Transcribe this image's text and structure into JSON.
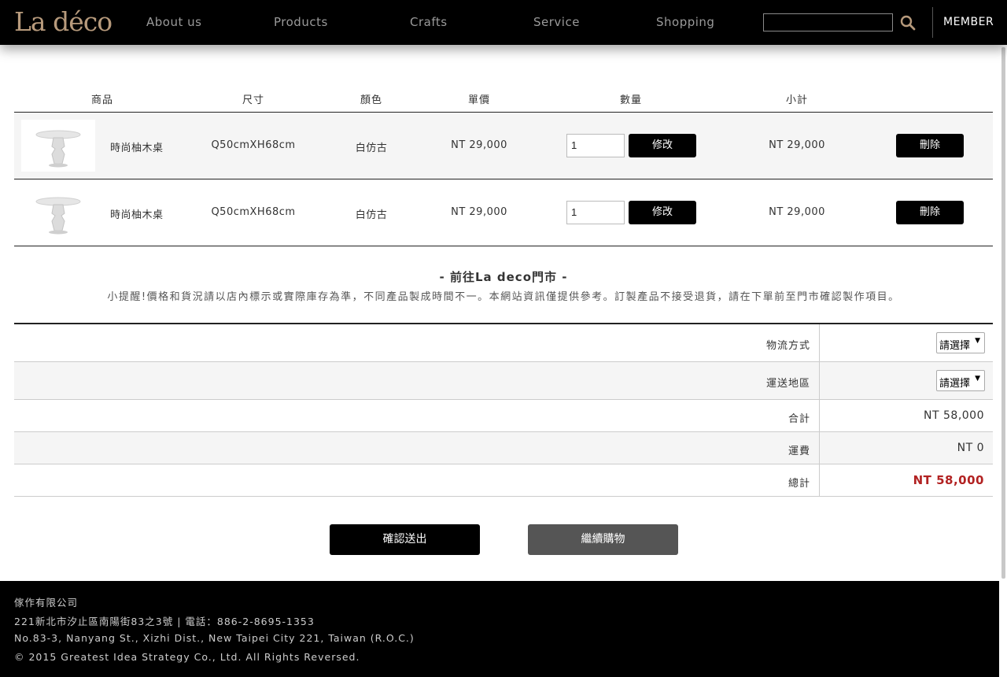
{
  "header": {
    "logo": "La déco",
    "nav": [
      "About us",
      "Products",
      "Crafts",
      "Service",
      "Shopping"
    ],
    "search_value": "",
    "member": "MEMBER"
  },
  "cart": {
    "columns": [
      "商品",
      "尺寸",
      "顏色",
      "單價",
      "數量",
      "小計"
    ],
    "rows": [
      {
        "name": "時尚柚木桌",
        "size": "Q50cmXH68cm",
        "color": "白仿古",
        "price": "NT 29,000",
        "qty": "1",
        "edit": "修改",
        "subtotal": "NT 29,000",
        "delete": "刪除"
      },
      {
        "name": "時尚柚木桌",
        "size": "Q50cmXH68cm",
        "color": "白仿古",
        "price": "NT 29,000",
        "qty": "1",
        "edit": "修改",
        "subtotal": "NT 29,000",
        "delete": "刪除"
      }
    ]
  },
  "notice": {
    "title": "- 前往La deco門市 -",
    "text": "小提醒!價格和貨況請以店內標示或實際庫存為準，不同產品製成時間不一。本網站資訊僅提供參考。訂製產品不接受退貨，請在下單前至門市確認製作項目。"
  },
  "summary": {
    "shipping_method_label": "物流方式",
    "shipping_method_value": "請選擇",
    "region_label": "運送地區",
    "region_value": "請選擇",
    "sum_label": "合計",
    "sum_value": "NT 58,000",
    "freight_label": "運費",
    "freight_value": "NT 0",
    "total_label": "總計",
    "total_value": "NT 58,000"
  },
  "actions": {
    "confirm": "確認送出",
    "continue": "繼續購物"
  },
  "footer": {
    "company": "傢作有限公司",
    "address_zh": "221新北市汐止區南陽街83之3號 | 電話：886-2-8695-1353",
    "address_en": "No.83-3, Nanyang St., Xizhi Dist., New Taipei City 221, Taiwan (R.O.C.)",
    "copyright": "© 2015 Greatest Idea Strategy Co., Ltd. All Rights Reversed."
  },
  "colors": {
    "logo": "#b79a7c",
    "total": "#b22222",
    "header_bg": "#000000"
  }
}
